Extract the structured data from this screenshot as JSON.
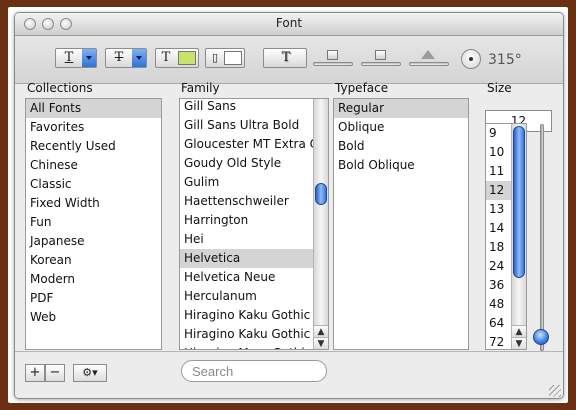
{
  "window": {
    "title": "Font"
  },
  "toolbar": {
    "underline_glyph": "T",
    "strike_glyph": "T",
    "text_color_glyph": "T",
    "text_color": "#c7e36a",
    "doc_color": "#ffffff",
    "shadow_glyph": "T",
    "angle": "315°"
  },
  "headers": {
    "collections": "Collections",
    "family": "Family",
    "typeface": "Typeface",
    "size": "Size"
  },
  "collections": [
    "All Fonts",
    "Favorites",
    "Recently Used",
    "Chinese",
    "Classic",
    "Fixed Width",
    "Fun",
    "Japanese",
    "Korean",
    "Modern",
    "PDF",
    "Web"
  ],
  "collections_selected": "All Fonts",
  "families": [
    "Gill Sans",
    "Gill Sans Ultra Bold",
    "Gloucester MT Extra Co",
    "Goudy Old Style",
    "Gulim",
    "Haettenschweiler",
    "Harrington",
    "Hei",
    "Helvetica",
    "Helvetica Neue",
    "Herculanum",
    "Hiragino Kaku Gothic P",
    "Hiragino Kaku Gothic S",
    "Hiragino Maru Gothic P"
  ],
  "family_selected": "Helvetica",
  "typefaces": [
    "Regular",
    "Oblique",
    "Bold",
    "Bold Oblique"
  ],
  "typeface_selected": "Regular",
  "size": {
    "value": "12",
    "options": [
      "9",
      "10",
      "11",
      "12",
      "13",
      "14",
      "18",
      "24",
      "36",
      "48",
      "64",
      "72"
    ],
    "selected": "12"
  },
  "bottom": {
    "add_label": "+",
    "remove_label": "−",
    "action_label": "⚙▾",
    "search_placeholder": "Search"
  },
  "colors": {
    "selection": "#d4d4d4",
    "scroll_accent": "#3a74d8",
    "frame": "#6b2f14"
  }
}
